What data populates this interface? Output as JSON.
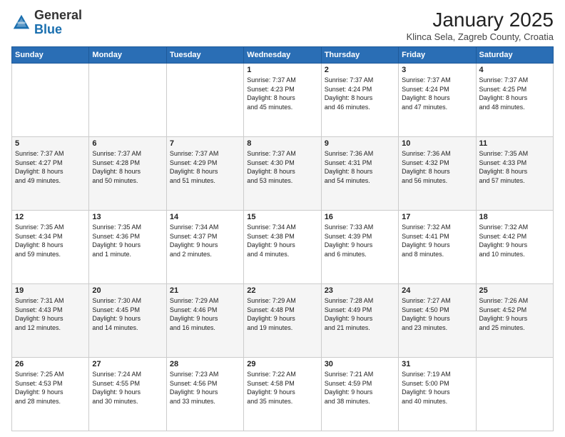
{
  "header": {
    "logo_general": "General",
    "logo_blue": "Blue",
    "month_title": "January 2025",
    "location": "Klinca Sela, Zagreb County, Croatia"
  },
  "weekdays": [
    "Sunday",
    "Monday",
    "Tuesday",
    "Wednesday",
    "Thursday",
    "Friday",
    "Saturday"
  ],
  "weeks": [
    [
      {
        "day": "",
        "info": ""
      },
      {
        "day": "",
        "info": ""
      },
      {
        "day": "",
        "info": ""
      },
      {
        "day": "1",
        "info": "Sunrise: 7:37 AM\nSunset: 4:23 PM\nDaylight: 8 hours\nand 45 minutes."
      },
      {
        "day": "2",
        "info": "Sunrise: 7:37 AM\nSunset: 4:24 PM\nDaylight: 8 hours\nand 46 minutes."
      },
      {
        "day": "3",
        "info": "Sunrise: 7:37 AM\nSunset: 4:24 PM\nDaylight: 8 hours\nand 47 minutes."
      },
      {
        "day": "4",
        "info": "Sunrise: 7:37 AM\nSunset: 4:25 PM\nDaylight: 8 hours\nand 48 minutes."
      }
    ],
    [
      {
        "day": "5",
        "info": "Sunrise: 7:37 AM\nSunset: 4:27 PM\nDaylight: 8 hours\nand 49 minutes."
      },
      {
        "day": "6",
        "info": "Sunrise: 7:37 AM\nSunset: 4:28 PM\nDaylight: 8 hours\nand 50 minutes."
      },
      {
        "day": "7",
        "info": "Sunrise: 7:37 AM\nSunset: 4:29 PM\nDaylight: 8 hours\nand 51 minutes."
      },
      {
        "day": "8",
        "info": "Sunrise: 7:37 AM\nSunset: 4:30 PM\nDaylight: 8 hours\nand 53 minutes."
      },
      {
        "day": "9",
        "info": "Sunrise: 7:36 AM\nSunset: 4:31 PM\nDaylight: 8 hours\nand 54 minutes."
      },
      {
        "day": "10",
        "info": "Sunrise: 7:36 AM\nSunset: 4:32 PM\nDaylight: 8 hours\nand 56 minutes."
      },
      {
        "day": "11",
        "info": "Sunrise: 7:35 AM\nSunset: 4:33 PM\nDaylight: 8 hours\nand 57 minutes."
      }
    ],
    [
      {
        "day": "12",
        "info": "Sunrise: 7:35 AM\nSunset: 4:34 PM\nDaylight: 8 hours\nand 59 minutes."
      },
      {
        "day": "13",
        "info": "Sunrise: 7:35 AM\nSunset: 4:36 PM\nDaylight: 9 hours\nand 1 minute."
      },
      {
        "day": "14",
        "info": "Sunrise: 7:34 AM\nSunset: 4:37 PM\nDaylight: 9 hours\nand 2 minutes."
      },
      {
        "day": "15",
        "info": "Sunrise: 7:34 AM\nSunset: 4:38 PM\nDaylight: 9 hours\nand 4 minutes."
      },
      {
        "day": "16",
        "info": "Sunrise: 7:33 AM\nSunset: 4:39 PM\nDaylight: 9 hours\nand 6 minutes."
      },
      {
        "day": "17",
        "info": "Sunrise: 7:32 AM\nSunset: 4:41 PM\nDaylight: 9 hours\nand 8 minutes."
      },
      {
        "day": "18",
        "info": "Sunrise: 7:32 AM\nSunset: 4:42 PM\nDaylight: 9 hours\nand 10 minutes."
      }
    ],
    [
      {
        "day": "19",
        "info": "Sunrise: 7:31 AM\nSunset: 4:43 PM\nDaylight: 9 hours\nand 12 minutes."
      },
      {
        "day": "20",
        "info": "Sunrise: 7:30 AM\nSunset: 4:45 PM\nDaylight: 9 hours\nand 14 minutes."
      },
      {
        "day": "21",
        "info": "Sunrise: 7:29 AM\nSunset: 4:46 PM\nDaylight: 9 hours\nand 16 minutes."
      },
      {
        "day": "22",
        "info": "Sunrise: 7:29 AM\nSunset: 4:48 PM\nDaylight: 9 hours\nand 19 minutes."
      },
      {
        "day": "23",
        "info": "Sunrise: 7:28 AM\nSunset: 4:49 PM\nDaylight: 9 hours\nand 21 minutes."
      },
      {
        "day": "24",
        "info": "Sunrise: 7:27 AM\nSunset: 4:50 PM\nDaylight: 9 hours\nand 23 minutes."
      },
      {
        "day": "25",
        "info": "Sunrise: 7:26 AM\nSunset: 4:52 PM\nDaylight: 9 hours\nand 25 minutes."
      }
    ],
    [
      {
        "day": "26",
        "info": "Sunrise: 7:25 AM\nSunset: 4:53 PM\nDaylight: 9 hours\nand 28 minutes."
      },
      {
        "day": "27",
        "info": "Sunrise: 7:24 AM\nSunset: 4:55 PM\nDaylight: 9 hours\nand 30 minutes."
      },
      {
        "day": "28",
        "info": "Sunrise: 7:23 AM\nSunset: 4:56 PM\nDaylight: 9 hours\nand 33 minutes."
      },
      {
        "day": "29",
        "info": "Sunrise: 7:22 AM\nSunset: 4:58 PM\nDaylight: 9 hours\nand 35 minutes."
      },
      {
        "day": "30",
        "info": "Sunrise: 7:21 AM\nSunset: 4:59 PM\nDaylight: 9 hours\nand 38 minutes."
      },
      {
        "day": "31",
        "info": "Sunrise: 7:19 AM\nSunset: 5:00 PM\nDaylight: 9 hours\nand 40 minutes."
      },
      {
        "day": "",
        "info": ""
      }
    ]
  ]
}
